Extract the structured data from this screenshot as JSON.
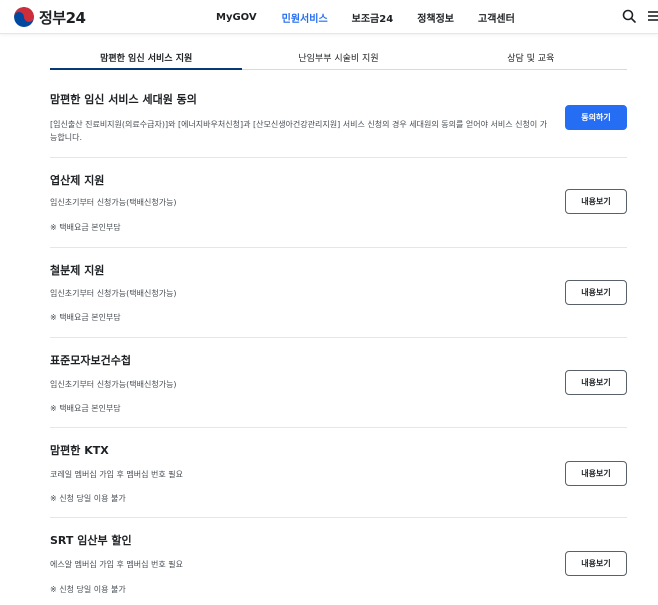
{
  "header": {
    "logo_text": "정부24",
    "nav": [
      "MyGOV",
      "민원서비스",
      "보조금24",
      "정책정보",
      "고객센터"
    ],
    "active_nav": 1
  },
  "tabs": [
    "맘편한 임신 서비스 지원",
    "난임부부 시술비 지원",
    "상담 및 교육"
  ],
  "consent": {
    "title": "맘편한 임신 서비스 세대원 동의",
    "desc": "[임신출산 진료비지원(의료수급자)]와 [에너지바우처신청]과 [산모신생아건강관리지원] 서비스 신청의 경우 세대원의 동의를 얻어야 서비스 신청이 가능합니다.",
    "button": "동의하기"
  },
  "services": [
    {
      "title": "엽산제 지원",
      "desc": "임신초기부터 신청가능(택배신청가능)",
      "note": "※ 택배요금 본인부담",
      "button": "내용보기"
    },
    {
      "title": "철분제 지원",
      "desc": "임신초기부터 신청가능(택배신청가능)",
      "note": "※ 택배요금 본인부담",
      "button": "내용보기"
    },
    {
      "title": "표준모자보건수첩",
      "desc": "임신초기부터 신청가능(택배신청가능)",
      "note": "※ 택배요금 본인부담",
      "button": "내용보기"
    },
    {
      "title": "맘편한 KTX",
      "desc": "코레일 멤버십 가입 후 멤버십 번호 필요",
      "note": "※ 신청 당일 이용 불가",
      "button": "내용보기"
    },
    {
      "title": "SRT 임산부 할인",
      "desc": "에스알 멤버십 가입 후 멤버십 번호 필요",
      "note": "※ 신청 당일 이용 불가",
      "button": "내용보기"
    }
  ],
  "colors": {
    "accent": "#256ef4",
    "navy": "#063a74",
    "logo_red": "#cd2e3a",
    "logo_blue": "#0047a0"
  },
  "icons": {
    "logo": "taegeuk-logo-icon",
    "search": "search-icon",
    "menu": "menu-icon"
  }
}
